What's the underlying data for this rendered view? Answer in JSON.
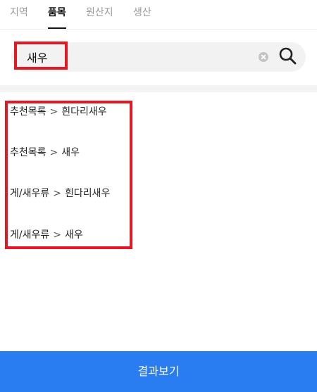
{
  "tabs": [
    {
      "label": "지역",
      "active": false
    },
    {
      "label": "품목",
      "active": true
    },
    {
      "label": "원산지",
      "active": false
    },
    {
      "label": "생산",
      "active": false
    }
  ],
  "search": {
    "value": "새우",
    "clear_icon": "clear-icon",
    "search_icon": "search-icon"
  },
  "results": [
    {
      "category": "추천목록",
      "separator": ">",
      "item": "흰다리새우"
    },
    {
      "category": "추천목록",
      "separator": ">",
      "item": "새우"
    },
    {
      "category": "게/새우류",
      "separator": ">",
      "item": "흰다리새우"
    },
    {
      "category": "게/새우류",
      "separator": ">",
      "item": "새우"
    }
  ],
  "footer": {
    "button_label": "결과보기"
  },
  "colors": {
    "accent": "#2a7df1",
    "highlight": "#e01a22"
  }
}
